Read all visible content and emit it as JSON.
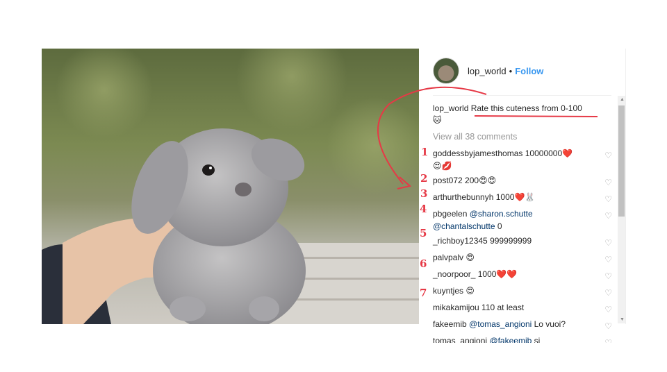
{
  "post": {
    "username": "lop_world",
    "follow_label": "Follow",
    "dot": "•",
    "caption_user": "lop_world",
    "caption_text": "Rate this cuteness from 0-100",
    "caption_emoji": "🐱",
    "view_all": "View all 38 comments"
  },
  "comments": [
    {
      "user": "goddessbyjamesthomas",
      "text": "10000000❤️",
      "text2": "😍💋"
    },
    {
      "user": "post072",
      "text": "200😍😍"
    },
    {
      "user": "arthurthebunnyh",
      "text": "1000❤️🐰"
    },
    {
      "user": "pbgeelen",
      "mention1": "@sharon.schutte",
      "mention2": "@chantalschutte",
      "tail": "0"
    },
    {
      "user": "_richboy12345",
      "text": "999999999"
    },
    {
      "user": "palvpalv",
      "text": "😍"
    },
    {
      "user": "_noorpoor_",
      "text": "1000❤️❤️"
    },
    {
      "user": "kuyntjes",
      "text": "😍"
    },
    {
      "user": "mikakamijou",
      "text": "110 at least"
    },
    {
      "user": "fakeemib",
      "mention1": "@tomas_angioni",
      "tail": "Lo vuoi?"
    },
    {
      "user": "tomas_angioni",
      "mention1": "@fakeemib",
      "tail": "si"
    }
  ],
  "annotations": {
    "numbers": [
      "1",
      "2",
      "3",
      "4",
      "5",
      "6",
      "7"
    ]
  },
  "icons": {
    "heart": "♡",
    "scroll_up": "▲",
    "scroll_down": "▼"
  },
  "colors": {
    "follow": "#3897f0",
    "mention": "#003569",
    "annotation": "#e63946"
  }
}
